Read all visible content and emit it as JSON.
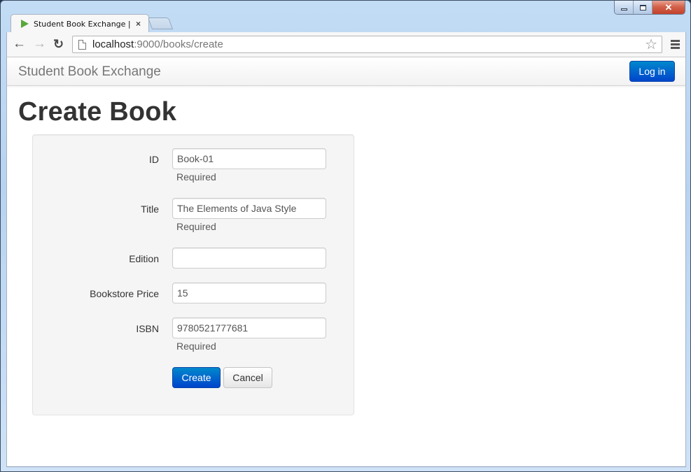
{
  "window": {
    "controls": {
      "minimize_label": "Minimize",
      "maximize_label": "Maximize",
      "close_glyph": "✕"
    }
  },
  "browser": {
    "tab": {
      "title": "Student Book Exchange | C",
      "close_glyph": "×"
    },
    "nav": {
      "back_glyph": "←",
      "forward_glyph": "→",
      "reload_glyph": "↻"
    },
    "url": {
      "host": "localhost",
      "path": ":9000/books/create"
    },
    "bookmark_glyph": "☆"
  },
  "navbar": {
    "brand": "Student Book Exchange",
    "login_label": "Log in"
  },
  "page": {
    "title": "Create Book"
  },
  "form": {
    "fields": [
      {
        "label": "ID",
        "value": "Book-01",
        "help": "Required"
      },
      {
        "label": "Title",
        "value": "The Elements of Java Style",
        "help": "Required"
      },
      {
        "label": "Edition",
        "value": "",
        "help": null
      },
      {
        "label": "Bookstore Price",
        "value": "15",
        "help": null
      },
      {
        "label": "ISBN",
        "value": "9780521777681",
        "help": "Required"
      }
    ],
    "create_label": "Create",
    "cancel_label": "Cancel"
  },
  "colors": {
    "primary": "#0055cc",
    "brand_text": "#777777",
    "well_bg": "#f5f5f5"
  }
}
